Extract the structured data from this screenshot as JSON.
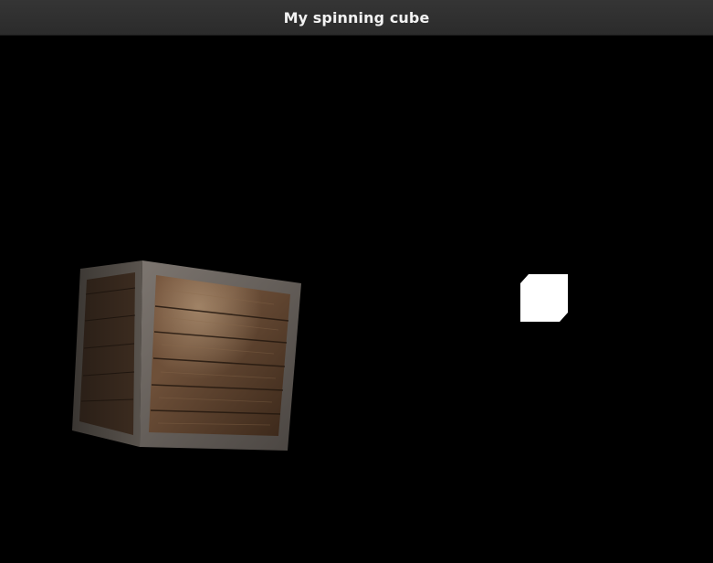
{
  "window": {
    "title": "My spinning cube"
  },
  "scene": {
    "background_color": "#000000",
    "light_color": "#ffffff",
    "cube_texture": "wooden-crate"
  }
}
